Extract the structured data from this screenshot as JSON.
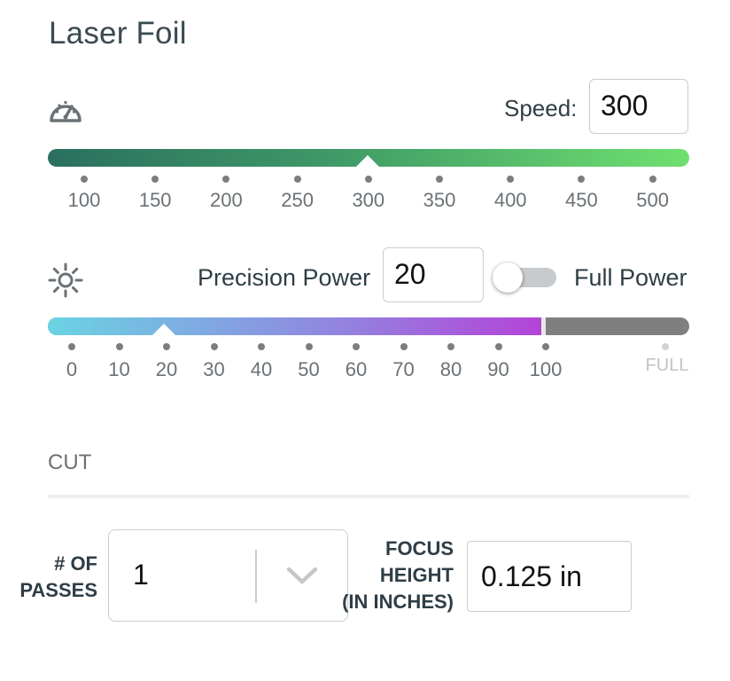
{
  "title": "Laser Foil",
  "speed": {
    "icon": "speedometer-icon",
    "label": "Speed:",
    "value": "300",
    "slider_value": 300,
    "ticks": [
      "100",
      "150",
      "200",
      "250",
      "300",
      "350",
      "400",
      "450",
      "500"
    ],
    "gradient": [
      "#2b6f5f",
      "#6fe06f"
    ]
  },
  "power": {
    "icon": "brightness-icon",
    "label": "Precision Power",
    "value": "20",
    "slider_value": 20,
    "toggle_label": "Full Power",
    "toggle_on": false,
    "ticks": [
      "0",
      "10",
      "20",
      "30",
      "40",
      "50",
      "60",
      "70",
      "80",
      "90",
      "100"
    ],
    "full_tick": "FULL",
    "gradient": [
      "#6ad3e3",
      "#b443d8"
    ]
  },
  "cut": {
    "heading": "CUT",
    "passes_label": [
      "# OF",
      "PASSES"
    ],
    "passes_value": "1",
    "chevron_icon": "chevron-down-icon",
    "focus_label": [
      "FOCUS",
      "HEIGHT",
      "(IN INCHES)"
    ],
    "focus_value": "0.125 in"
  }
}
